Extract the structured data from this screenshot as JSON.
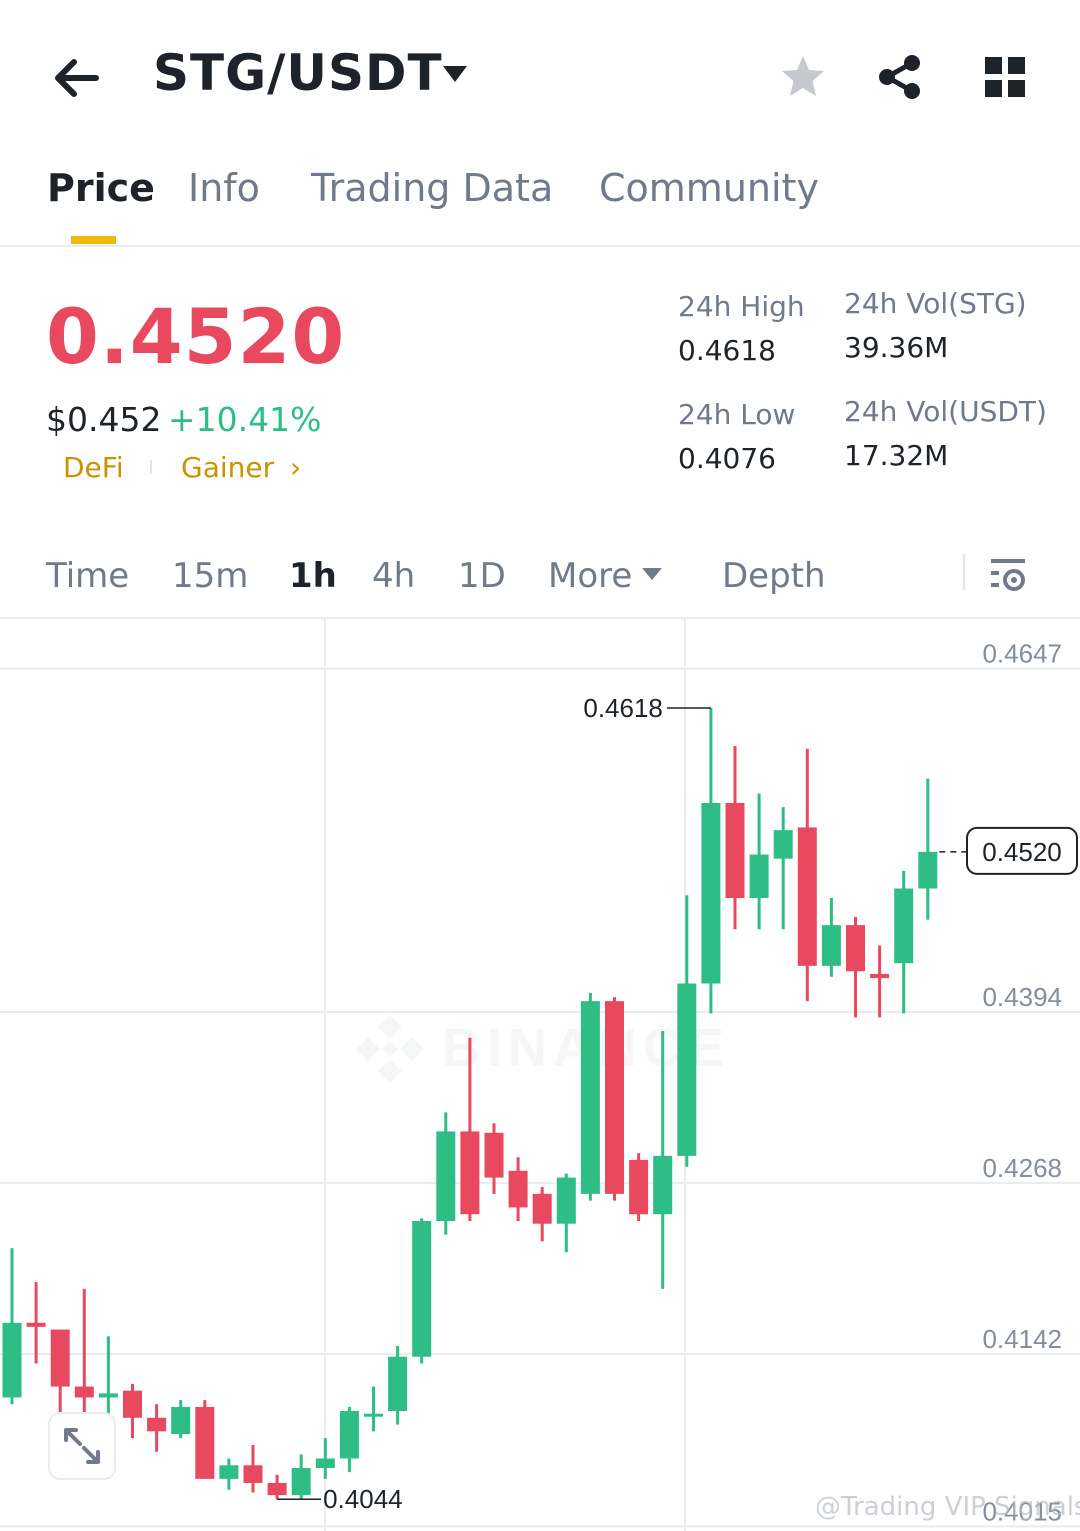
{
  "header": {
    "pair": "STG/USDT",
    "icons": [
      "back-arrow-icon",
      "dropdown-caret-icon",
      "star-icon",
      "share-icon",
      "grid-menu-icon"
    ]
  },
  "tabs": [
    {
      "label": "Price",
      "active": true
    },
    {
      "label": "Info",
      "active": false
    },
    {
      "label": "Trading Data",
      "active": false
    },
    {
      "label": "Community",
      "active": false
    }
  ],
  "ticker": {
    "last_price": "0.4520",
    "usd_price": "$0.452",
    "change_pct": "+10.41%",
    "tags": [
      "DeFi",
      "Gainer"
    ],
    "tag_arrow": "›",
    "stats": [
      {
        "label": "24h High",
        "value": "0.4618"
      },
      {
        "label": "24h Vol(STG)",
        "value": "39.36M"
      },
      {
        "label": "24h Low",
        "value": "0.4076"
      },
      {
        "label": "24h Vol(USDT)",
        "value": "17.32M"
      }
    ]
  },
  "intervals": [
    {
      "label": "Time",
      "active": false
    },
    {
      "label": "15m",
      "active": false
    },
    {
      "label": "1h",
      "active": true
    },
    {
      "label": "4h",
      "active": false
    },
    {
      "label": "1D",
      "active": false
    },
    {
      "label": "More",
      "active": false
    },
    {
      "label": "Depth",
      "active": false
    }
  ],
  "colors": {
    "up": "#2ebd85",
    "down": "#e8495f",
    "accent": "#f0b90b",
    "grid": "#eaecef"
  },
  "chart_data": {
    "type": "candlestick",
    "y_ticks": [
      0.4647,
      0.4394,
      0.4268,
      0.4142,
      0.4015
    ],
    "y_tick_labels": [
      "0.4647",
      "0.4394",
      "0.4268",
      "0.4142",
      "0.4015"
    ],
    "last_price_label": "0.4520",
    "high_marker": "0.4618",
    "low_marker": "0.4044",
    "watermark": "BINANCE",
    "candles": [
      {
        "o": 0.411,
        "h": 0.422,
        "l": 0.4105,
        "c": 0.4165
      },
      {
        "o": 0.4165,
        "h": 0.4195,
        "l": 0.4135,
        "c": 0.4162
      },
      {
        "o": 0.416,
        "h": 0.412,
        "l": 0.4085,
        "c": 0.4118,
        "fix": true
      },
      {
        "o": 0.4118,
        "h": 0.419,
        "l": 0.4095,
        "c": 0.411
      },
      {
        "o": 0.411,
        "h": 0.4155,
        "l": 0.409,
        "c": 0.4113
      },
      {
        "o": 0.4115,
        "h": 0.412,
        "l": 0.408,
        "c": 0.4095
      },
      {
        "o": 0.4095,
        "h": 0.4105,
        "l": 0.407,
        "c": 0.4085
      },
      {
        "o": 0.4083,
        "h": 0.4108,
        "l": 0.408,
        "c": 0.4103
      },
      {
        "o": 0.4103,
        "h": 0.4108,
        "l": 0.405,
        "c": 0.405
      },
      {
        "o": 0.405,
        "h": 0.4065,
        "l": 0.4042,
        "c": 0.406
      },
      {
        "o": 0.406,
        "h": 0.4075,
        "l": 0.404,
        "c": 0.4047
      },
      {
        "o": 0.4047,
        "h": 0.4053,
        "l": 0.4035,
        "c": 0.4038
      },
      {
        "o": 0.4038,
        "h": 0.4068,
        "l": 0.4035,
        "c": 0.4058
      },
      {
        "o": 0.4058,
        "h": 0.408,
        "l": 0.405,
        "c": 0.4065
      },
      {
        "o": 0.4065,
        "h": 0.4103,
        "l": 0.4055,
        "c": 0.41
      },
      {
        "o": 0.4098,
        "h": 0.4118,
        "l": 0.4085,
        "c": 0.4098
      },
      {
        "o": 0.41,
        "h": 0.4148,
        "l": 0.409,
        "c": 0.414
      },
      {
        "o": 0.414,
        "h": 0.4242,
        "l": 0.4135,
        "c": 0.424
      },
      {
        "o": 0.424,
        "h": 0.432,
        "l": 0.423,
        "c": 0.4306
      },
      {
        "o": 0.4306,
        "h": 0.4375,
        "l": 0.424,
        "c": 0.4245
      },
      {
        "o": 0.4305,
        "h": 0.4312,
        "l": 0.426,
        "c": 0.4272
      },
      {
        "o": 0.4277,
        "h": 0.4287,
        "l": 0.424,
        "c": 0.425
      },
      {
        "o": 0.426,
        "h": 0.4265,
        "l": 0.4225,
        "c": 0.4238
      },
      {
        "o": 0.4238,
        "h": 0.4275,
        "l": 0.4217,
        "c": 0.4272
      },
      {
        "o": 0.426,
        "h": 0.4408,
        "l": 0.4255,
        "c": 0.4402
      },
      {
        "o": 0.4402,
        "h": 0.4405,
        "l": 0.4255,
        "c": 0.426
      },
      {
        "o": 0.4285,
        "h": 0.429,
        "l": 0.424,
        "c": 0.4245
      },
      {
        "o": 0.4245,
        "h": 0.438,
        "l": 0.419,
        "c": 0.4288
      },
      {
        "o": 0.4288,
        "h": 0.448,
        "l": 0.428,
        "c": 0.4415
      },
      {
        "o": 0.4415,
        "h": 0.4618,
        "l": 0.4393,
        "c": 0.4548
      },
      {
        "o": 0.4548,
        "h": 0.459,
        "l": 0.4455,
        "c": 0.4478
      },
      {
        "o": 0.4478,
        "h": 0.4555,
        "l": 0.4455,
        "c": 0.451
      },
      {
        "o": 0.4507,
        "h": 0.4545,
        "l": 0.4455,
        "c": 0.4528
      },
      {
        "o": 0.453,
        "h": 0.4588,
        "l": 0.4402,
        "c": 0.4428
      },
      {
        "o": 0.4428,
        "h": 0.4478,
        "l": 0.442,
        "c": 0.4458
      },
      {
        "o": 0.4458,
        "h": 0.4464,
        "l": 0.439,
        "c": 0.4424
      },
      {
        "o": 0.4422,
        "h": 0.4443,
        "l": 0.439,
        "c": 0.4419
      },
      {
        "o": 0.443,
        "h": 0.4498,
        "l": 0.4393,
        "c": 0.4485
      },
      {
        "o": 0.4485,
        "h": 0.4566,
        "l": 0.4462,
        "c": 0.4512
      }
    ]
  },
  "credit": "@Trading VIP Signals"
}
